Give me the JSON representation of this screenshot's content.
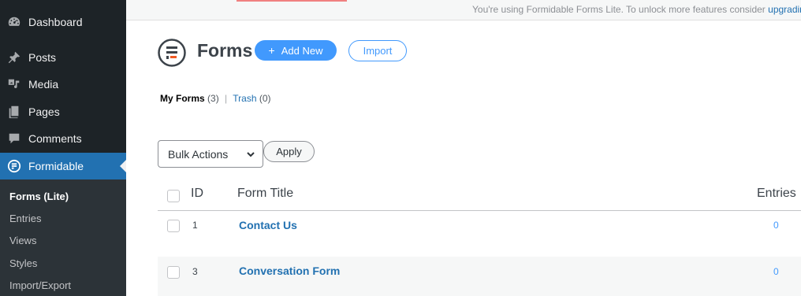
{
  "notice": {
    "text": "You're using Formidable Forms Lite. To unlock more features consider ",
    "link": "upgrading to PRO."
  },
  "sidebar": {
    "items": [
      {
        "label": "Dashboard",
        "icon": "dashboard-icon"
      },
      {
        "label": "Posts",
        "icon": "pin-icon"
      },
      {
        "label": "Media",
        "icon": "media-icon"
      },
      {
        "label": "Pages",
        "icon": "pages-icon"
      },
      {
        "label": "Comments",
        "icon": "comment-icon"
      },
      {
        "label": "Formidable",
        "icon": "formidable-icon"
      }
    ],
    "submenu": [
      {
        "label": "Forms (Lite)"
      },
      {
        "label": "Entries"
      },
      {
        "label": "Views"
      },
      {
        "label": "Styles"
      },
      {
        "label": "Import/Export"
      }
    ]
  },
  "header": {
    "title": "Forms",
    "add_new": "Add New",
    "import": "Import"
  },
  "filters": {
    "my_forms": "My Forms",
    "my_forms_count": "(3)",
    "separator": "|",
    "trash": "Trash",
    "trash_count": "(0)"
  },
  "bulk": {
    "selected": "Bulk Actions",
    "apply": "Apply"
  },
  "table": {
    "columns": {
      "id": "ID",
      "title": "Form Title",
      "entries": "Entries"
    },
    "rows": [
      {
        "id": "1",
        "title": "Contact Us",
        "entries": "0"
      },
      {
        "id": "3",
        "title": "Conversation Form",
        "entries": "0"
      }
    ]
  },
  "colors": {
    "sidebar_bg": "#1d2327",
    "active": "#2271b1",
    "accent": "#4199fd",
    "brand_orange": "#f15a24"
  }
}
